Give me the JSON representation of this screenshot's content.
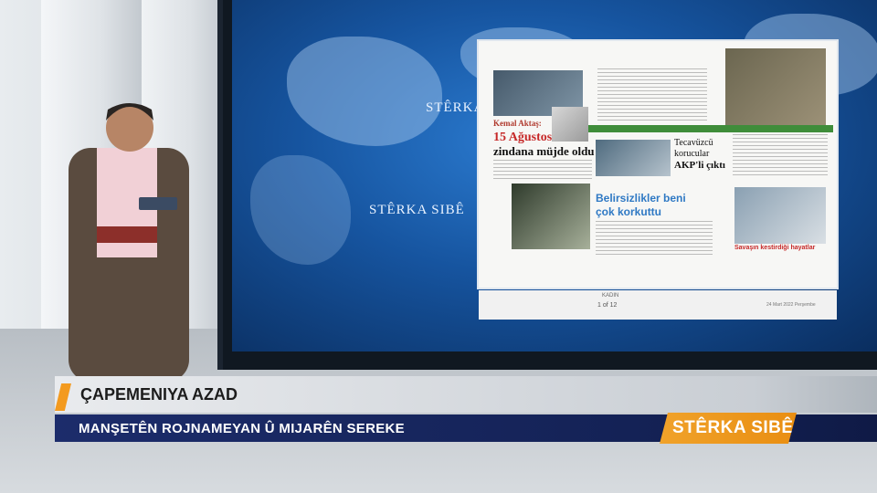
{
  "lower_third": {
    "title": "ÇAPEMENIYA AZAD",
    "subtitle": "MANŞETÊN ROJNAMEYAN Û MIJARÊN SEREKE",
    "logo": "STÊRKA SIBÊ",
    "accent_color": "#f39a1f",
    "band_color": "#1c2c6b"
  },
  "video_wall": {
    "brand_text_1": "STÊRKA SIBÊ",
    "brand_text_2": "STÊRKA S"
  },
  "newspaper": {
    "headline_main": "15 Ağustos",
    "headline_main_2": "zindana müjde oldu",
    "byline": "Kemal Aktaş:",
    "headline_center_1": "Tecavüzcü",
    "headline_center_2": "korucular",
    "headline_center_3": "AKP'li çıktı",
    "headline_interview": "Belirsizlikler beni",
    "headline_interview_2": "çok korkuttu",
    "headline_right": "Savaşın kestirdiği hayatlar",
    "pager": "1 of 12",
    "section": "KADIN",
    "date": "24 Mart 2022 Perşembe"
  }
}
